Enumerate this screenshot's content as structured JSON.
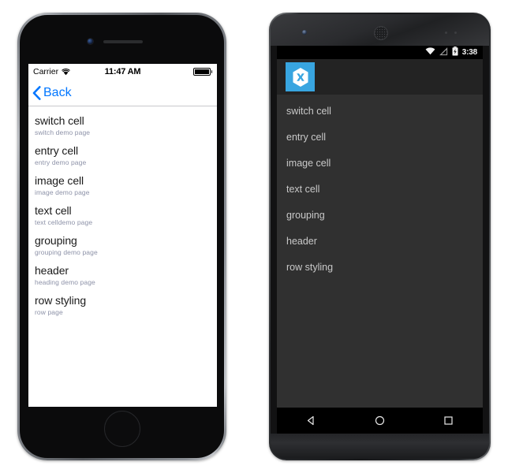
{
  "iphone": {
    "status_bar": {
      "carrier": "Carrier",
      "wifi_icon": "wifi-icon",
      "time": "11:47 AM",
      "battery_icon": "battery-full-icon"
    },
    "nav_bar": {
      "back_icon": "chevron-left-icon",
      "back_label": "Back"
    },
    "hardware": {
      "camera": "front-camera",
      "speaker": "earpiece-speaker",
      "home_button": "home-button"
    },
    "list": [
      {
        "title": "switch cell",
        "subtitle": "switch demo page"
      },
      {
        "title": "entry cell",
        "subtitle": "entry demo page"
      },
      {
        "title": "image cell",
        "subtitle": "image demo page"
      },
      {
        "title": "text cell",
        "subtitle": "text celldemo page"
      },
      {
        "title": "grouping",
        "subtitle": "grouping demo page"
      },
      {
        "title": "header",
        "subtitle": "heading demo page"
      },
      {
        "title": "row styling",
        "subtitle": "row page"
      }
    ]
  },
  "android": {
    "status_bar": {
      "wifi_icon": "wifi-icon",
      "signal_icon": "cell-signal-icon",
      "battery_icon": "battery-charging-icon",
      "time": "3:38"
    },
    "action_bar": {
      "logo_icon": "xamarin-logo-icon"
    },
    "hardware": {
      "camera": "front-camera",
      "speaker": "earpiece-speaker",
      "sensors": "proximity-sensors"
    },
    "list": [
      {
        "title": "switch cell"
      },
      {
        "title": "entry cell"
      },
      {
        "title": "image cell"
      },
      {
        "title": "text cell"
      },
      {
        "title": "grouping"
      },
      {
        "title": "header"
      },
      {
        "title": "row styling"
      }
    ],
    "nav_bar": {
      "back_icon": "nav-back-triangle-icon",
      "home_icon": "nav-home-circle-icon",
      "recents_icon": "nav-recents-square-icon"
    }
  },
  "colors": {
    "ios_blue": "#0076ff",
    "ios_subtitle": "#8d92a8",
    "android_accent": "#38a5e0",
    "android_list_bg": "#303030",
    "android_actionbar_bg": "#232323"
  }
}
